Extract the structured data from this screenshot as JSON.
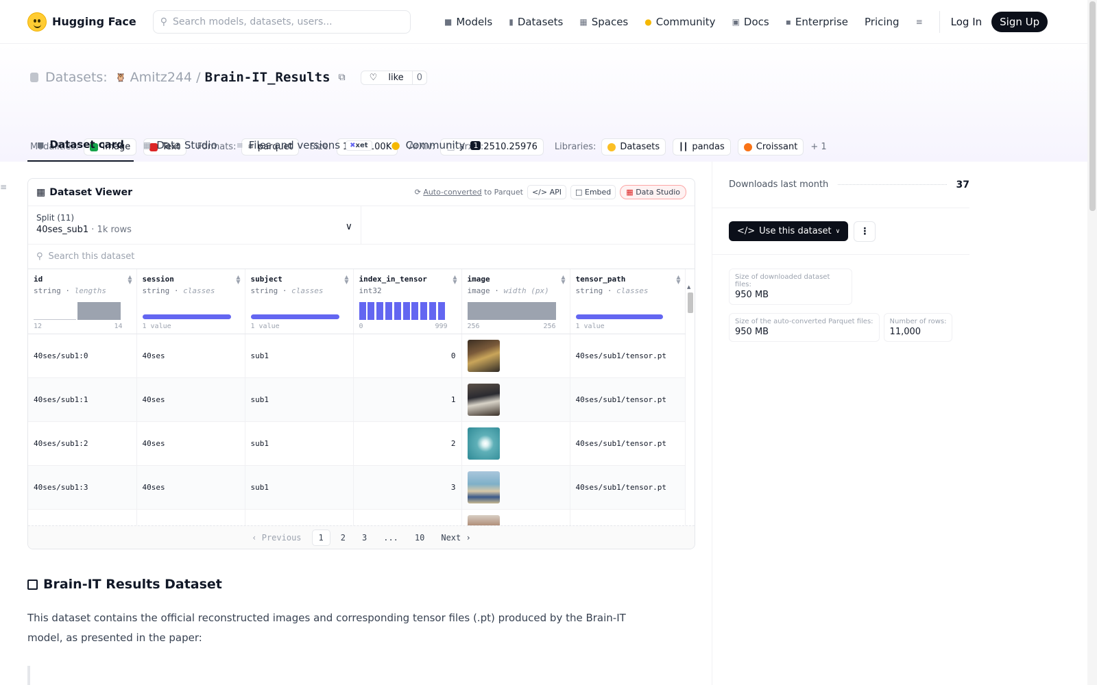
{
  "nav": {
    "brand": "Hugging Face",
    "search_placeholder": "Search models, datasets, users...",
    "links": [
      "Models",
      "Datasets",
      "Spaces",
      "Community",
      "Docs",
      "Enterprise",
      "Pricing"
    ],
    "login": "Log In",
    "signup": "Sign Up"
  },
  "header": {
    "section": "Datasets:",
    "owner": "Amitz244",
    "sep": "/",
    "name": "Brain-IT_Results",
    "like_label": "like",
    "like_count": "0",
    "modalities_label": "Modalities:",
    "modalities": [
      "Image",
      "Text"
    ],
    "formats_label": "Formats:",
    "format": "parquet",
    "size_label": "Size:",
    "size": "10K - 100K",
    "arxiv_label": "ArXiv:",
    "arxiv_prefix": "arxiv:",
    "arxiv_id": "2510.25976",
    "libraries_label": "Libraries:",
    "libraries": [
      "Datasets",
      "pandas",
      "Croissant"
    ],
    "more_libraries": "+ 1"
  },
  "tabs": {
    "card": "Dataset card",
    "studio": "Data Studio",
    "files": "Files and versions",
    "xet": "xet",
    "community": "Community",
    "community_count": "1"
  },
  "viewer": {
    "title": "Dataset Viewer",
    "auto_converted": "Auto-converted",
    "to_parquet": "to Parquet",
    "api": "API",
    "embed": "Embed",
    "data_studio": "Data Studio",
    "split_label": "Split (11)",
    "split_value": "40ses_sub1",
    "split_rows": "1k rows",
    "search_placeholder": "Search this dataset",
    "columns": [
      {
        "name": "id",
        "type": "string",
        "sub": "lengths",
        "min": "12",
        "max": "14"
      },
      {
        "name": "session",
        "type": "string",
        "sub": "classes",
        "min": "1 value",
        "max": ""
      },
      {
        "name": "subject",
        "type": "string",
        "sub": "classes",
        "min": "1 value",
        "max": ""
      },
      {
        "name": "index_in_tensor",
        "type": "int32",
        "sub": "",
        "min": "0",
        "max": "999"
      },
      {
        "name": "image",
        "type": "image",
        "sub": "width (px)",
        "min": "256",
        "max": "256"
      },
      {
        "name": "tensor_path",
        "type": "string",
        "sub": "classes",
        "min": "1 value",
        "max": ""
      }
    ],
    "rows": [
      {
        "id": "40ses/sub1:0",
        "session": "40ses",
        "subject": "sub1",
        "index": "0",
        "path": "40ses/sub1/tensor.pt"
      },
      {
        "id": "40ses/sub1:1",
        "session": "40ses",
        "subject": "sub1",
        "index": "1",
        "path": "40ses/sub1/tensor.pt"
      },
      {
        "id": "40ses/sub1:2",
        "session": "40ses",
        "subject": "sub1",
        "index": "2",
        "path": "40ses/sub1/tensor.pt"
      },
      {
        "id": "40ses/sub1:3",
        "session": "40ses",
        "subject": "sub1",
        "index": "3",
        "path": "40ses/sub1/tensor.pt"
      }
    ],
    "pager": {
      "prev": "Previous",
      "pages": [
        "1",
        "2",
        "3",
        "...",
        "10"
      ],
      "next": "Next"
    }
  },
  "card": {
    "title": "Brain-IT Results Dataset",
    "text": "This dataset contains the official reconstructed images and corresponding tensor files (.pt) produced by the Brain-IT model, as presented in the paper:"
  },
  "sidebar": {
    "downloads_label": "Downloads last month",
    "downloads": "37",
    "use_button": "Use this dataset",
    "stats": [
      {
        "label": "Size of downloaded dataset files:",
        "value": "950 MB"
      },
      {
        "label": "Size of the auto-converted Parquet files:",
        "value": "950 MB"
      },
      {
        "label": "Number of rows:",
        "value": "11,000"
      }
    ]
  }
}
